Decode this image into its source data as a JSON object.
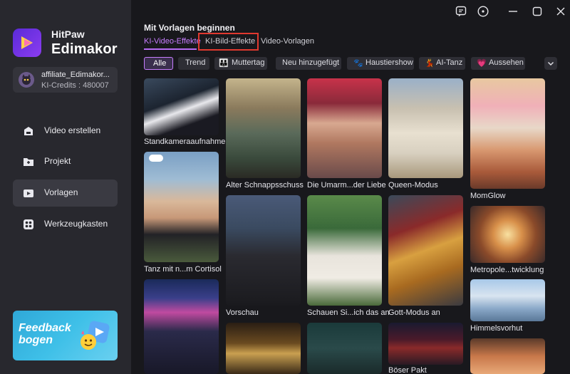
{
  "app": {
    "brand_small": "HitPaw",
    "brand_big": "Edimakor"
  },
  "account": {
    "name": "affiliate_Edimakor...",
    "credits": "KI-Credits : 480007"
  },
  "nav": [
    {
      "label": "Video erstellen",
      "icon": "video-create-icon"
    },
    {
      "label": "Projekt",
      "icon": "folder-icon"
    },
    {
      "label": "Vorlagen",
      "icon": "template-icon"
    },
    {
      "label": "Werkzeugkasten",
      "icon": "toolbox-icon"
    }
  ],
  "feedback": {
    "label": "Feedback bogen"
  },
  "window_controls": [
    "feedback-icon",
    "info-icon",
    "minimize-icon",
    "maximize-icon",
    "close-icon"
  ],
  "main": {
    "title": "Mit Vorlagen beginnen",
    "tabs": [
      "KI-Video-Effekte",
      "KI-Bild-Effekte",
      "Video-Vorlagen"
    ],
    "active_tab": "KI-Video-Effekte",
    "filters": [
      "Alle",
      "Trend",
      "Muttertag",
      "Neu hinzugefügt",
      "Haustiershow",
      "AI-Tanz",
      "Aussehen"
    ],
    "active_filter": "Alle"
  },
  "cards": [
    {
      "label": "Standkameraaufnahme",
      "col": 0
    },
    {
      "label": "Tanz mit n...m Cortisol",
      "col": 0
    },
    {
      "label": "",
      "col": 0
    },
    {
      "label": "Alter Schnappsschuss",
      "col": 1
    },
    {
      "label": "Vorschau",
      "col": 1
    },
    {
      "label": "",
      "col": 1
    },
    {
      "label": "Die Umarm...der Liebe",
      "col": 2
    },
    {
      "label": "Schauen Si...ich das an",
      "col": 2
    },
    {
      "label": "",
      "col": 2
    },
    {
      "label": "Queen-Modus",
      "col": 3
    },
    {
      "label": "Gott-Modus an",
      "col": 3
    },
    {
      "label": "Böser Pakt",
      "col": 3
    },
    {
      "label": "MomGlow",
      "col": 4
    },
    {
      "label": "Metropole...twicklung",
      "col": 4
    },
    {
      "label": "Himmelsvorhut",
      "col": 4
    },
    {
      "label": "",
      "col": 4
    }
  ],
  "colors": {
    "accent": "#c77dff",
    "highlight": "#e0392f",
    "sidebar_bg": "#28282e",
    "main_bg": "#18181c"
  }
}
